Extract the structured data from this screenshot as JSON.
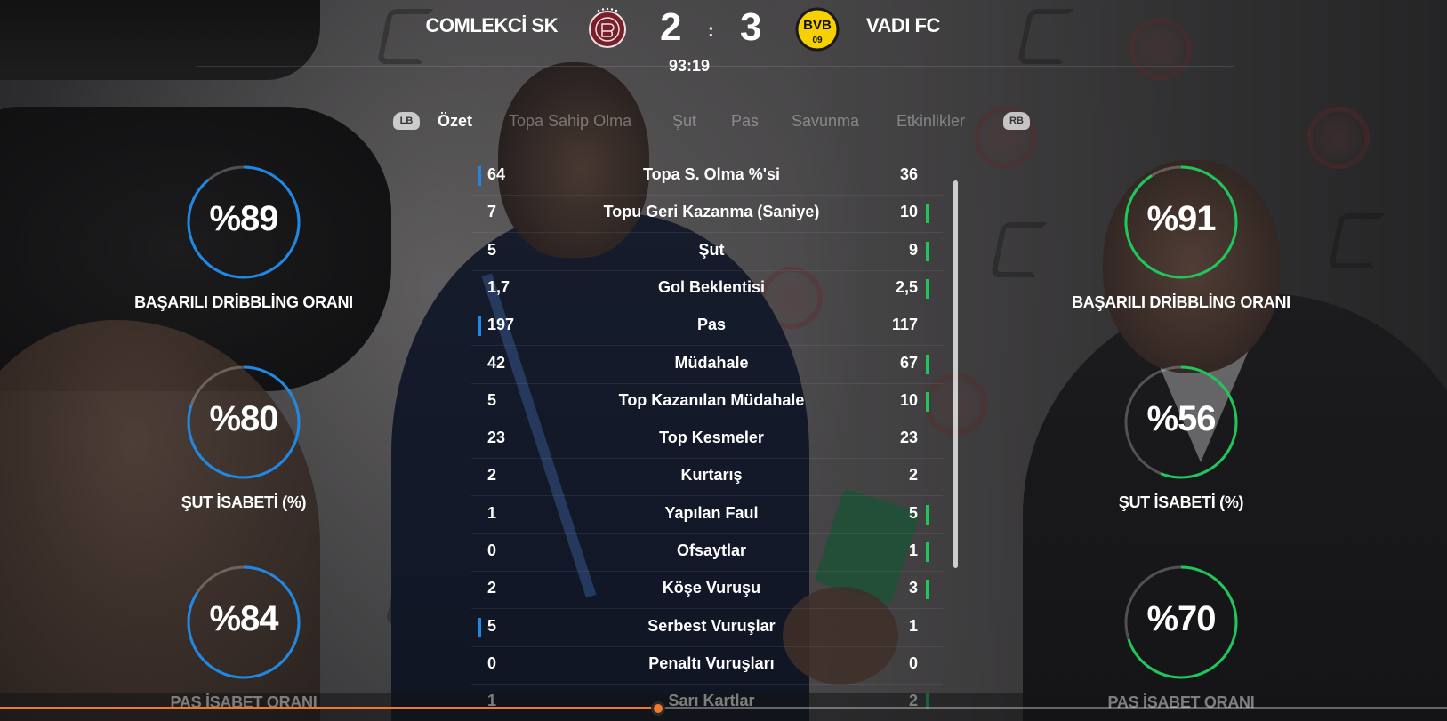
{
  "match": {
    "home_team": "COMLEKCİ SK",
    "away_team": "VADI FC",
    "home_score": "2",
    "away_score": "3",
    "separator": ":",
    "clock": "93:19",
    "away_crest_text": "BVB",
    "away_crest_year": "09"
  },
  "tabs": {
    "left_bumper": "LB",
    "right_bumper": "RB",
    "items": [
      "Özet",
      "Topa Sahip Olma",
      "Şut",
      "Pas",
      "Savunma",
      "Etkinlikler"
    ],
    "active_index": 0
  },
  "colors": {
    "home_accent": "#1e88e5",
    "away_accent": "#1ec75a",
    "timeline_accent": "#f07a2a"
  },
  "gauges": {
    "home": [
      {
        "value_text": "%89",
        "percent": 89,
        "label": "BAŞARILI DRİBBLİNG ORANI"
      },
      {
        "value_text": "%80",
        "percent": 80,
        "label": "ŞUT İSABETİ (%)"
      },
      {
        "value_text": "%84",
        "percent": 84,
        "label": "PAS İSABET ORANI"
      }
    ],
    "away": [
      {
        "value_text": "%91",
        "percent": 91,
        "label": "BAŞARILI DRİBBLİNG ORANI"
      },
      {
        "value_text": "%56",
        "percent": 56,
        "label": "ŞUT İSABETİ (%)"
      },
      {
        "value_text": "%70",
        "percent": 70,
        "label": "PAS İSABET ORANI"
      }
    ]
  },
  "stats": [
    {
      "home": "64",
      "label": "Topa S. Olma %'si",
      "away": "36",
      "leader": "home"
    },
    {
      "home": "7",
      "label": "Topu Geri Kazanma (Saniye)",
      "away": "10",
      "leader": "away"
    },
    {
      "home": "5",
      "label": "Şut",
      "away": "9",
      "leader": "away"
    },
    {
      "home": "1,7",
      "label": "Gol Beklentisi",
      "away": "2,5",
      "leader": "away"
    },
    {
      "home": "197",
      "label": "Pas",
      "away": "117",
      "leader": "home"
    },
    {
      "home": "42",
      "label": "Müdahale",
      "away": "67",
      "leader": "away"
    },
    {
      "home": "5",
      "label": "Top Kazanılan Müdahale",
      "away": "10",
      "leader": "away"
    },
    {
      "home": "23",
      "label": "Top Kesmeler",
      "away": "23",
      "leader": "none"
    },
    {
      "home": "2",
      "label": "Kurtarış",
      "away": "2",
      "leader": "none"
    },
    {
      "home": "1",
      "label": "Yapılan Faul",
      "away": "5",
      "leader": "away"
    },
    {
      "home": "0",
      "label": "Ofsaytlar",
      "away": "1",
      "leader": "away"
    },
    {
      "home": "2",
      "label": "Köşe Vuruşu",
      "away": "3",
      "leader": "away"
    },
    {
      "home": "5",
      "label": "Serbest Vuruşlar",
      "away": "1",
      "leader": "home"
    },
    {
      "home": "0",
      "label": "Penaltı Vuruşları",
      "away": "0",
      "leader": "none"
    },
    {
      "home": "1",
      "label": "Sarı Kartlar",
      "away": "2",
      "leader": "away"
    }
  ],
  "timeline": {
    "progress": 0.455
  }
}
